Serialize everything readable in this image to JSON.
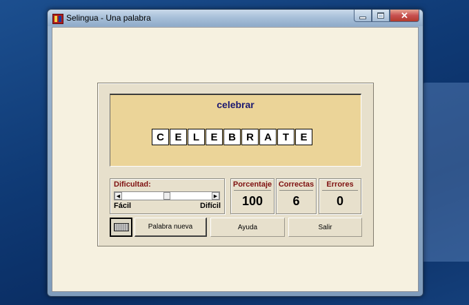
{
  "window": {
    "title": "Selingua - Una palabra",
    "controls": {
      "minimize_icon": "minimize-icon",
      "maximize_icon": "maximize-icon",
      "close_glyph": "✕"
    }
  },
  "exercise": {
    "spanish_word": "celebrar",
    "letters": [
      "C",
      "E",
      "L",
      "E",
      "B",
      "R",
      "A",
      "T",
      "E"
    ]
  },
  "difficulty": {
    "title": "Dificultad:",
    "min_label": "Fácil",
    "max_label": "Difícil",
    "level_fraction": 0.5,
    "left_arrow": "◀",
    "right_arrow": "▶"
  },
  "stats": {
    "percentage": {
      "label": "Porcentaje",
      "value": "100"
    },
    "correct": {
      "label": "Correctas",
      "value": "6"
    },
    "errors": {
      "label": "Errores",
      "value": "0"
    }
  },
  "buttons": {
    "keyboard_icon": "keyboard-icon",
    "new_word": "Palabra nueva",
    "help": "Ayuda",
    "exit": "Salir"
  },
  "colors": {
    "word_area_bg": "#ebd498",
    "spanish_word": "#1a1770",
    "group_title": "#7e1010",
    "panel_bg": "#e7e0cc"
  }
}
